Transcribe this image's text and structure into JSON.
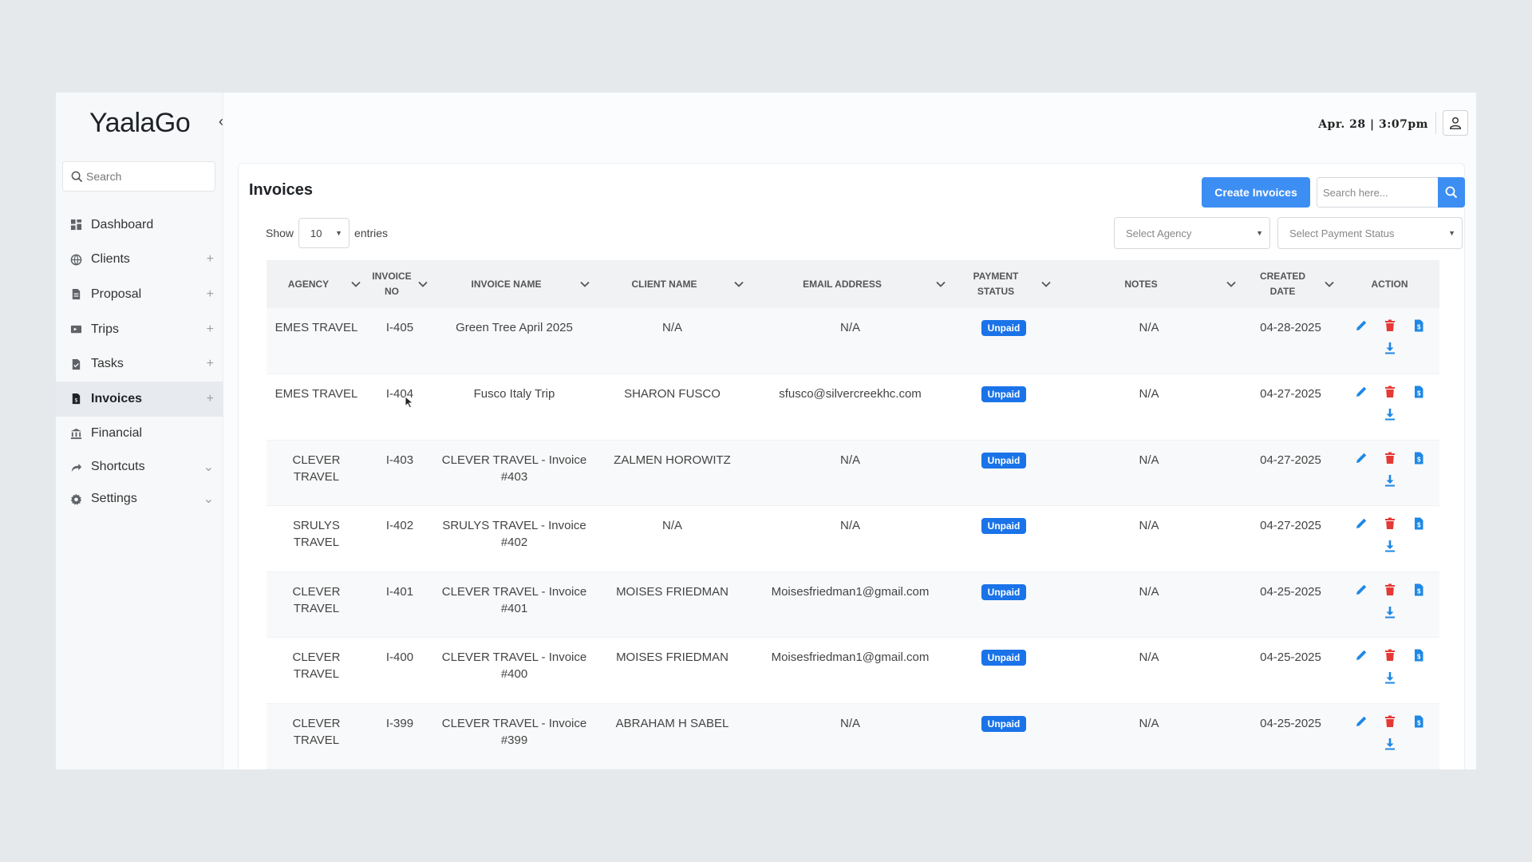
{
  "app": {
    "logo": "YaalaGo"
  },
  "sidebar": {
    "search_placeholder": "Search",
    "items": [
      {
        "label": "Dashboard",
        "icon": "dashboard-icon",
        "extra": ""
      },
      {
        "label": "Clients",
        "icon": "globe-icon",
        "extra": "+"
      },
      {
        "label": "Proposal",
        "icon": "document-icon",
        "extra": "+"
      },
      {
        "label": "Trips",
        "icon": "ticket-icon",
        "extra": "+"
      },
      {
        "label": "Tasks",
        "icon": "task-icon",
        "extra": "+"
      },
      {
        "label": "Invoices",
        "icon": "invoice-icon",
        "extra": "+"
      },
      {
        "label": "Financial",
        "icon": "bank-icon",
        "extra": ""
      },
      {
        "label": "Shortcuts",
        "icon": "share-icon",
        "extra": "⌄"
      },
      {
        "label": "Settings",
        "icon": "gear-icon",
        "extra": "⌄"
      }
    ]
  },
  "header": {
    "datetime": "Apr. 28 | 3:07pm"
  },
  "page": {
    "title": "Invoices",
    "create_button": "Create Invoices",
    "search_placeholder": "Search here...",
    "show_label": "Show",
    "entries_label": "entries",
    "entries_value": "10",
    "agency_placeholder": "Select Agency",
    "status_placeholder": "Select Payment Status"
  },
  "table": {
    "headers": [
      "AGENCY",
      "INVOICE NO",
      "INVOICE NAME",
      "CLIENT NAME",
      "EMAIL ADDRESS",
      "PAYMENT STATUS",
      "NOTES",
      "CREATED DATE",
      "ACTION"
    ],
    "rows": [
      {
        "agency": "EMES TRAVEL",
        "invoice_no": "I-405",
        "invoice_name": "Green Tree April 2025",
        "client": "N/A",
        "email": "N/A",
        "status": "Unpaid",
        "notes": "N/A",
        "date": "04-28-2025"
      },
      {
        "agency": "EMES TRAVEL",
        "invoice_no": "I-404",
        "invoice_name": "Fusco Italy Trip",
        "client": "SHARON FUSCO",
        "email": "sfusco@silvercreekhc.com",
        "status": "Unpaid",
        "notes": "N/A",
        "date": "04-27-2025"
      },
      {
        "agency": "CLEVER TRAVEL",
        "invoice_no": "I-403",
        "invoice_name": "CLEVER TRAVEL - Invoice #403",
        "client": "ZALMEN HOROWITZ",
        "email": "N/A",
        "status": "Unpaid",
        "notes": "N/A",
        "date": "04-27-2025"
      },
      {
        "agency": "SRULYS TRAVEL",
        "invoice_no": "I-402",
        "invoice_name": "SRULYS TRAVEL - Invoice #402",
        "client": "N/A",
        "email": "N/A",
        "status": "Unpaid",
        "notes": "N/A",
        "date": "04-27-2025"
      },
      {
        "agency": "CLEVER TRAVEL",
        "invoice_no": "I-401",
        "invoice_name": "CLEVER TRAVEL - Invoice #401",
        "client": "MOISES FRIEDMAN",
        "email": "Moisesfriedman1@gmail.com",
        "status": "Unpaid",
        "notes": "N/A",
        "date": "04-25-2025"
      },
      {
        "agency": "CLEVER TRAVEL",
        "invoice_no": "I-400",
        "invoice_name": "CLEVER TRAVEL - Invoice #400",
        "client": "MOISES FRIEDMAN",
        "email": "Moisesfriedman1@gmail.com",
        "status": "Unpaid",
        "notes": "N/A",
        "date": "04-25-2025"
      },
      {
        "agency": "CLEVER TRAVEL",
        "invoice_no": "I-399",
        "invoice_name": "CLEVER TRAVEL - Invoice #399",
        "client": "ABRAHAM H SABEL",
        "email": "N/A",
        "status": "Unpaid",
        "notes": "N/A",
        "date": "04-25-2025"
      }
    ]
  },
  "colors": {
    "accent": "#3c8ef3",
    "badge": "#1a73e8",
    "delete": "#e53935",
    "edit": "#1e88e5"
  }
}
